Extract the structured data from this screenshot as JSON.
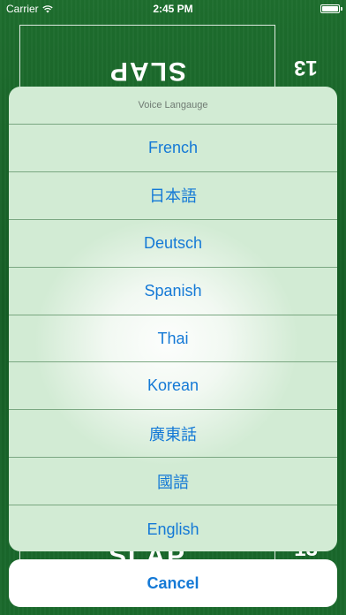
{
  "status_bar": {
    "carrier": "Carrier",
    "time": "2:45 PM",
    "battery_level": 1.0
  },
  "game": {
    "top_label": "SLAP",
    "top_score": "13",
    "bottom_label": "SLAP",
    "bottom_score": "13"
  },
  "action_sheet": {
    "title": "Voice Langauge",
    "options": [
      {
        "label": "French"
      },
      {
        "label": "日本語"
      },
      {
        "label": "Deutsch"
      },
      {
        "label": "Spanish"
      },
      {
        "label": "Thai"
      },
      {
        "label": "Korean"
      },
      {
        "label": "廣東話"
      },
      {
        "label": "國語"
      },
      {
        "label": "English"
      }
    ],
    "cancel_label": "Cancel"
  },
  "colors": {
    "table_green": "#17612a",
    "accent_blue": "#1479d6",
    "sheet_tint": "#cde8cf"
  }
}
